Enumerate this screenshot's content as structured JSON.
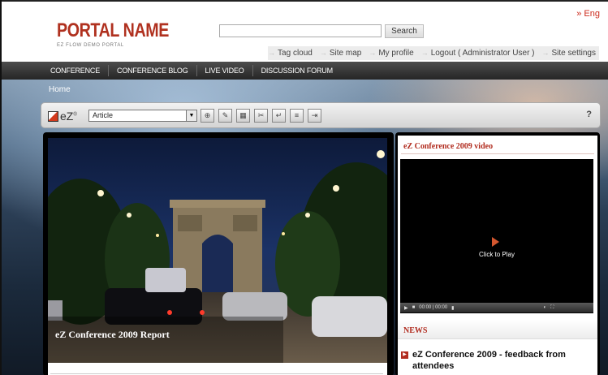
{
  "header": {
    "portal_name": "PORTAL NAME",
    "portal_subtitle": "EZ FLOW DEMO PORTAL",
    "language": "» Eng",
    "search_button": "Search",
    "search_value": ""
  },
  "utility_links": [
    "Tag cloud",
    "Site map",
    "My profile",
    "Logout ( Administrator User )",
    "Site settings"
  ],
  "nav": [
    "CONFERENCE",
    "CONFERENCE BLOG",
    "LIVE VIDEO",
    "DISCUSSION FORUM"
  ],
  "breadcrumb": "Home",
  "toolbar": {
    "logo_text": "eZ",
    "class_select_value": "Article",
    "help": "?"
  },
  "feature": {
    "caption": "eZ Conference 2009 Report"
  },
  "video": {
    "title": "eZ Conference 2009 video",
    "click_to_play": "Click to Play",
    "time": "00:00 | 00:00"
  },
  "news": {
    "title": "NEWS",
    "items": [
      "eZ Conference 2009 - feedback from attendees"
    ]
  }
}
